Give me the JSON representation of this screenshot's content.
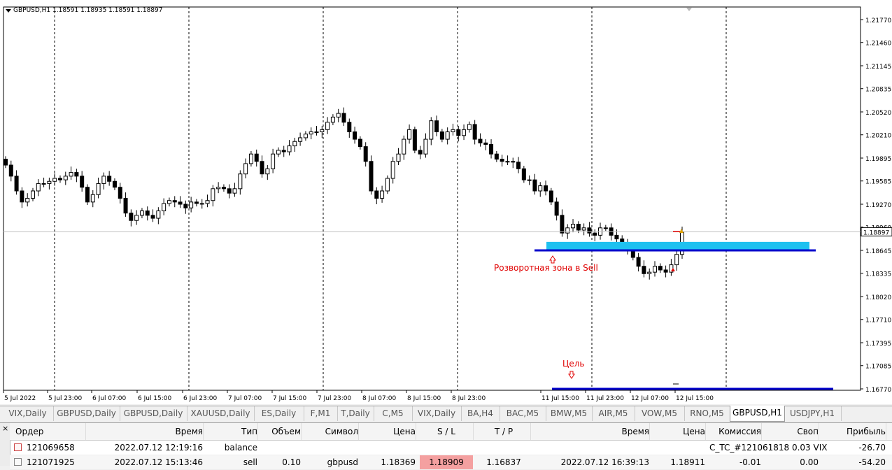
{
  "chart": {
    "symbol_info": "GBPUSD,H1  1.18591 1.18935 1.18591 1.18897",
    "current_price": "1.18897",
    "price_labels": [
      "1.21770",
      "1.21460",
      "1.21145",
      "1.20835",
      "1.20520",
      "1.20210",
      "1.19895",
      "1.19585",
      "1.19270",
      "1.18960",
      "1.18645",
      "1.18335",
      "1.18020",
      "1.17710",
      "1.17395",
      "1.17085",
      "1.16770"
    ],
    "time_labels": [
      "5 Jul 2022",
      "5 Jul 23:00",
      "6 Jul 07:00",
      "6 Jul 15:00",
      "6 Jul 23:00",
      "7 Jul 07:00",
      "7 Jul 15:00",
      "7 Jul 23:00",
      "8 Jul 07:00",
      "8 Jul 15:00",
      "8 Jul 23:00",
      "11 Jul 15:00",
      "11 Jul 23:00",
      "12 Jul 07:00",
      "12 Jul 15:00"
    ],
    "annotations": {
      "reversal_zone": "Розворотная зона в Sell",
      "target": "Цель"
    },
    "colors": {
      "zone": "#1ec1f0",
      "line": "#0000cc",
      "label": "#e00000"
    }
  },
  "chart_data": {
    "type": "candlestick",
    "symbol": "GBPUSD",
    "timeframe": "H1",
    "ohlc_last": {
      "open": 1.18591,
      "high": 1.18935,
      "low": 1.18591,
      "close": 1.18897
    },
    "closes": [
      1.198,
      1.1965,
      1.1945,
      1.193,
      1.1935,
      1.1945,
      1.1955,
      1.1955,
      1.1958,
      1.1962,
      1.196,
      1.1965,
      1.197,
      1.1965,
      1.195,
      1.193,
      1.194,
      1.1955,
      1.1965,
      1.1958,
      1.195,
      1.1935,
      1.1915,
      1.1905,
      1.1912,
      1.1918,
      1.1912,
      1.1908,
      1.1918,
      1.1928,
      1.1932,
      1.193,
      1.1927,
      1.1922,
      1.193,
      1.1928,
      1.1928,
      1.1932,
      1.1948,
      1.195,
      1.1948,
      1.1942,
      1.1948,
      1.1968,
      1.1982,
      1.1995,
      1.1985,
      1.1968,
      1.1975,
      1.1995,
      1.2,
      1.1998,
      1.2006,
      1.2012,
      1.2017,
      1.2022,
      1.2025,
      1.2025,
      1.2028,
      1.2038,
      1.2045,
      1.205,
      1.2038,
      1.2025,
      1.2015,
      1.2005,
      1.1985,
      1.1945,
      1.1935,
      1.1945,
      1.1962,
      1.1985,
      1.1995,
      1.2015,
      1.2028,
      1.2,
      1.1995,
      1.2015,
      1.204,
      1.2025,
      1.2015,
      1.2025,
      1.2028,
      1.202,
      1.2028,
      1.2035,
      1.2015,
      1.201,
      1.2008,
      1.1995,
      1.1988,
      1.1985,
      1.1985,
      1.1984,
      1.1975,
      1.196,
      1.196,
      1.1945,
      1.1952,
      1.1945,
      1.193,
      1.1912,
      1.1888,
      1.1895,
      1.19,
      1.1892,
      1.1895,
      1.1888,
      1.1885,
      1.1895,
      1.1895,
      1.1885,
      1.188,
      1.1873,
      1.1865,
      1.1855,
      1.1843,
      1.1833,
      1.1835,
      1.1843,
      1.1838,
      1.1835,
      1.1845,
      1.18591,
      1.18897
    ],
    "ylim": [
      1.1677,
      1.2177
    ],
    "horizontal_line": 1.18645,
    "target_line": 1.1677,
    "zone": {
      "from": 1.18645,
      "to": 1.1876
    }
  },
  "tabs": [
    {
      "label": "VIX,Daily"
    },
    {
      "label": "GBPUSD,Daily"
    },
    {
      "label": "GBPUSD,Daily"
    },
    {
      "label": "XAUUSD,Daily"
    },
    {
      "label": "ES,Daily"
    },
    {
      "label": "F,M1"
    },
    {
      "label": "T,Daily"
    },
    {
      "label": "C,M5"
    },
    {
      "label": "VIX,Daily"
    },
    {
      "label": "BA,H4"
    },
    {
      "label": "BAC,M5"
    },
    {
      "label": "BMW,M5"
    },
    {
      "label": "AIR,M5"
    },
    {
      "label": "VOW,M5"
    },
    {
      "label": "RNO,M5"
    },
    {
      "label": "GBPUSD,H1"
    },
    {
      "label": "USDJPY,H1"
    }
  ],
  "terminal": {
    "close_icon": "×",
    "headers": [
      "Ордер",
      "Время",
      "Тип",
      "Объем",
      "Символ",
      "Цена",
      "S / L",
      "T / P",
      "Время",
      "Цена",
      "Комиссия",
      "Своп",
      "Прибыль"
    ],
    "rows": [
      {
        "order": "121069658",
        "time": "2022.07.12 12:19:16",
        "type": "balance",
        "volume": "",
        "symbol": "",
        "price": "",
        "sl": "",
        "tp": "",
        "close_time": "",
        "close_price": "",
        "commission": "C_TC_#121061818 0.03 VIX",
        "swap": "",
        "profit": "-26.70"
      },
      {
        "order": "121071925",
        "time": "2022.07.12 15:13:46",
        "type": "sell",
        "volume": "0.10",
        "symbol": "gbpusd",
        "price": "1.18369",
        "sl": "1.18909",
        "tp": "1.16837",
        "close_time": "2022.07.12 16:39:13",
        "close_price": "1.18911",
        "commission": "-0.01",
        "swap": "0.00",
        "profit": "-54.20"
      }
    ]
  }
}
